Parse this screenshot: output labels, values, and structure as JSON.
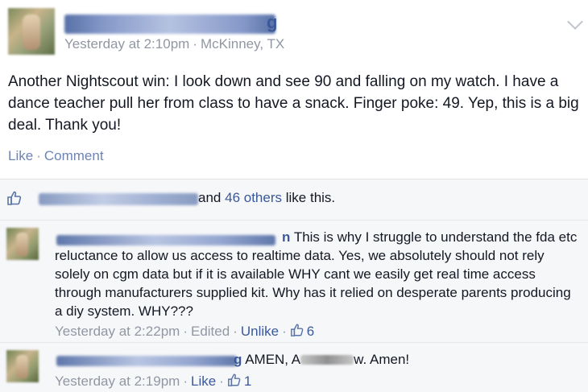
{
  "post": {
    "author_tail": "g",
    "timestamp": "Yesterday at 2:10pm",
    "separator": "·",
    "location": "McKinney, TX",
    "text": "Another Nightscout win: I look down and see 90 and falling on my watch. I have a dance teacher pull her from class to have a snack. Finger poke: 49. Yep, this is a big deal. Thank you!",
    "actions": {
      "like": "Like",
      "sep": "·",
      "comment": "Comment"
    }
  },
  "likes": {
    "and": "and",
    "others": "46 others",
    "suffix": "like this."
  },
  "comments": [
    {
      "name_tail": "n",
      "text": "This is why I struggle to understand the fda etc reluctance to allow us access to realtime data. Yes, we absolutely should not rely solely on cgm data but if it is available WHY cant we easily get real time access through manufacturers supplied kit. Why has it relied on desperate parents producing a diy system. WHY???",
      "timestamp": "Yesterday at 2:22pm",
      "edited": "Edited",
      "action": "Unlike",
      "like_count": "6"
    },
    {
      "name_tail": "g",
      "text_start": "AMEN, A",
      "text_end": "w. Amen!",
      "timestamp": "Yesterday at 2:19pm",
      "action": "Like",
      "like_count": "1"
    }
  ],
  "colors": {
    "link": "#3b5998",
    "meta": "#9197a3",
    "text": "#141823",
    "ufi_bg": "#f6f7f9"
  },
  "icons": [
    "chevron-down-icon",
    "thumbs-up-icon"
  ]
}
